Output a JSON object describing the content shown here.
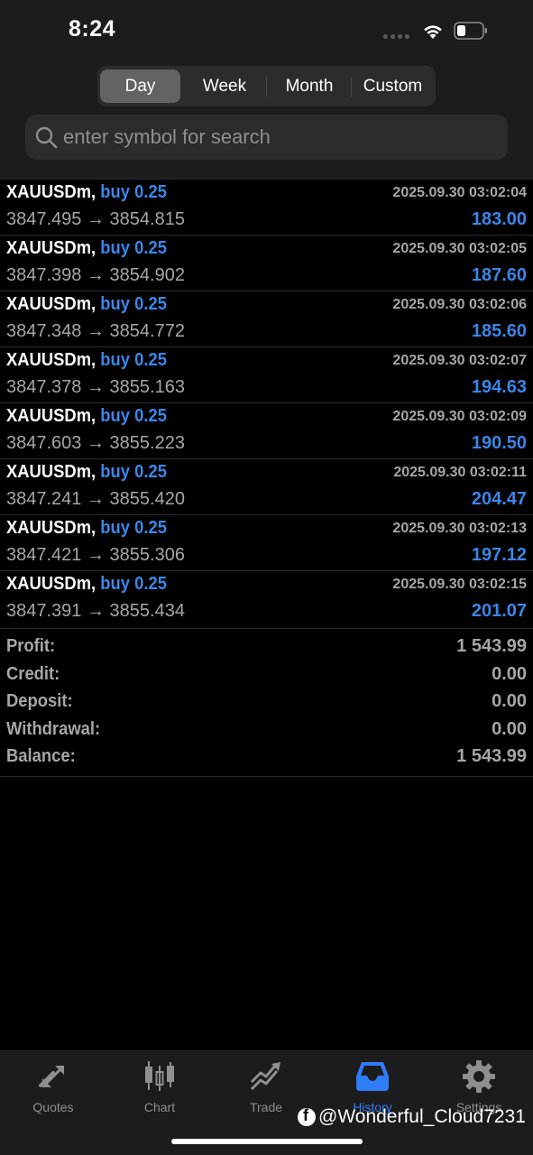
{
  "status_bar": {
    "time": "8:24"
  },
  "filters": {
    "tabs": [
      {
        "label": "Day",
        "active": true
      },
      {
        "label": "Week",
        "active": false
      },
      {
        "label": "Month",
        "active": false
      },
      {
        "label": "Custom",
        "active": false
      }
    ]
  },
  "search": {
    "placeholder": "enter symbol for search",
    "value": ""
  },
  "deals": [
    {
      "symbol": "XAUUSDm,",
      "side": "buy 0.25",
      "datetime": "2025.09.30 03:02:04",
      "prices": "3847.495 → 3854.815",
      "profit": "183.00"
    },
    {
      "symbol": "XAUUSDm,",
      "side": "buy 0.25",
      "datetime": "2025.09.30 03:02:05",
      "prices": "3847.398 → 3854.902",
      "profit": "187.60"
    },
    {
      "symbol": "XAUUSDm,",
      "side": "buy 0.25",
      "datetime": "2025.09.30 03:02:06",
      "prices": "3847.348 → 3854.772",
      "profit": "185.60"
    },
    {
      "symbol": "XAUUSDm,",
      "side": "buy 0.25",
      "datetime": "2025.09.30 03:02:07",
      "prices": "3847.378 → 3855.163",
      "profit": "194.63"
    },
    {
      "symbol": "XAUUSDm,",
      "side": "buy 0.25",
      "datetime": "2025.09.30 03:02:09",
      "prices": "3847.603 → 3855.223",
      "profit": "190.50"
    },
    {
      "symbol": "XAUUSDm,",
      "side": "buy 0.25",
      "datetime": "2025.09.30 03:02:11",
      "prices": "3847.241 → 3855.420",
      "profit": "204.47"
    },
    {
      "symbol": "XAUUSDm,",
      "side": "buy 0.25",
      "datetime": "2025.09.30 03:02:13",
      "prices": "3847.421 → 3855.306",
      "profit": "197.12"
    },
    {
      "symbol": "XAUUSDm,",
      "side": "buy 0.25",
      "datetime": "2025.09.30 03:02:15",
      "prices": "3847.391 → 3855.434",
      "profit": "201.07"
    }
  ],
  "summary": {
    "profit_label": "Profit:",
    "profit_value": "1 543.99",
    "credit_label": "Credit:",
    "credit_value": "0.00",
    "deposit_label": "Deposit:",
    "deposit_value": "0.00",
    "withdrawal_label": "Withdrawal:",
    "withdrawal_value": "0.00",
    "balance_label": "Balance:",
    "balance_value": "1 543.99"
  },
  "tabbar": {
    "items": [
      {
        "label": "Quotes",
        "icon": "quotes-icon",
        "active": false
      },
      {
        "label": "Chart",
        "icon": "candlestick-chart-icon",
        "active": false
      },
      {
        "label": "Trade",
        "icon": "trade-trend-icon",
        "active": false
      },
      {
        "label": "History",
        "icon": "inbox-tray-icon",
        "active": true
      },
      {
        "label": "Settings",
        "icon": "gear-icon",
        "active": false
      }
    ]
  },
  "watermark": {
    "text": "@Wonderful_Cloud7231",
    "icon": "facebook-icon"
  },
  "colors": {
    "accent": "#3a86e8",
    "background": "#000000",
    "secondary_text": "#a6a6aa"
  }
}
